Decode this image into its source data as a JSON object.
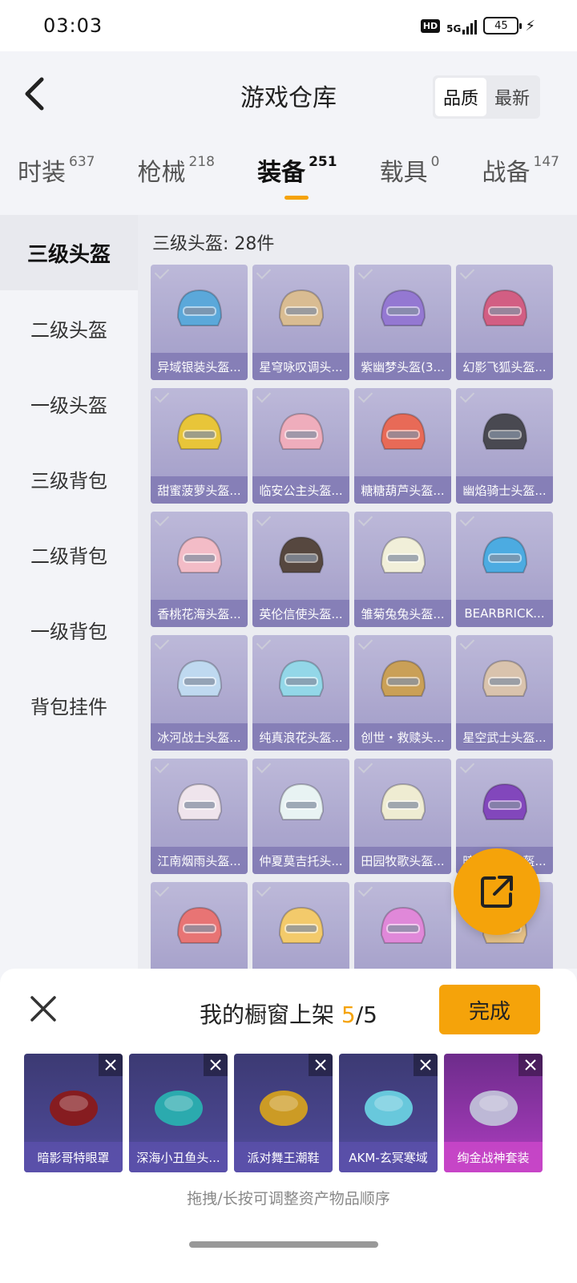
{
  "status_bar": {
    "time": "03:03",
    "hd": "HD",
    "network": "5G",
    "battery": "45"
  },
  "header": {
    "title": "游戏仓库",
    "sort_options": [
      "品质",
      "最新"
    ],
    "sort_selected": "品质"
  },
  "tabs": [
    {
      "label": "时装",
      "count": "637"
    },
    {
      "label": "枪械",
      "count": "218"
    },
    {
      "label": "装备",
      "count": "251"
    },
    {
      "label": "载具",
      "count": "0"
    },
    {
      "label": "战备",
      "count": "147"
    }
  ],
  "sidebar": {
    "items": [
      "三级头盔",
      "二级头盔",
      "一级头盔",
      "三级背包",
      "二级背包",
      "一级背包",
      "背包挂件"
    ],
    "active": "三级头盔"
  },
  "content": {
    "heading": "三级头盔: 28件",
    "items": [
      {
        "name": "异域银装头盔...",
        "color": "#4fa3d9"
      },
      {
        "name": "星穹咏叹调头...",
        "color": "#d8b98a"
      },
      {
        "name": "紫幽梦头盔(3...",
        "color": "#8d6fd0"
      },
      {
        "name": "幻影飞狐头盔...",
        "color": "#d0537a"
      },
      {
        "name": "甜蜜菠萝头盔...",
        "color": "#e8c22a"
      },
      {
        "name": "临安公主头盔...",
        "color": "#f0a8b8"
      },
      {
        "name": "糖糖葫芦头盔...",
        "color": "#e8604a"
      },
      {
        "name": "幽焰骑士头盔...",
        "color": "#3c3c44"
      },
      {
        "name": "香桃花海头盔...",
        "color": "#f4b8c4"
      },
      {
        "name": "英伦信使头盔...",
        "color": "#4a3a30"
      },
      {
        "name": "雏菊兔兔头盔...",
        "color": "#f2f0d8"
      },
      {
        "name": "BEARBRICK...",
        "color": "#3fa6e0"
      },
      {
        "name": "冰河战士头盔...",
        "color": "#bcd8f0"
      },
      {
        "name": "纯真浪花头盔...",
        "color": "#8cd6e8"
      },
      {
        "name": "创世・救赎头...",
        "color": "#c89a4a"
      },
      {
        "name": "星空武士头盔...",
        "color": "#d8c0a8"
      },
      {
        "name": "江南烟雨头盔...",
        "color": "#f0e4ec"
      },
      {
        "name": "仲夏莫吉托头...",
        "color": "#e8f4f4"
      },
      {
        "name": "田园牧歌头盔...",
        "color": "#f0ecd0"
      },
      {
        "name": "暗夜霓虹头盔...",
        "color": "#7a3ab8"
      },
      {
        "name": "",
        "color": "#e86a6a"
      },
      {
        "name": "",
        "color": "#f4c860"
      },
      {
        "name": "",
        "color": "#e080d8"
      },
      {
        "name": "",
        "color": "#e8c080"
      }
    ]
  },
  "share_icon": "share-icon",
  "sheet": {
    "title_prefix": "我的橱窗上架 ",
    "count_current": "5",
    "count_total": "/5",
    "done_label": "完成",
    "hint": "拖拽/长按可调整资产物品顺序",
    "items": [
      {
        "name": "暗影哥特眼罩",
        "color": "#8a1a1a"
      },
      {
        "name": "深海小丑鱼头...",
        "color": "#2ab0b0"
      },
      {
        "name": "派对舞王潮鞋",
        "color": "#d4a020"
      },
      {
        "name": "AKM-玄冥寒域",
        "color": "#6ad0e0"
      },
      {
        "name": "绚金战神套装",
        "color": "#c0c0d8"
      }
    ]
  }
}
